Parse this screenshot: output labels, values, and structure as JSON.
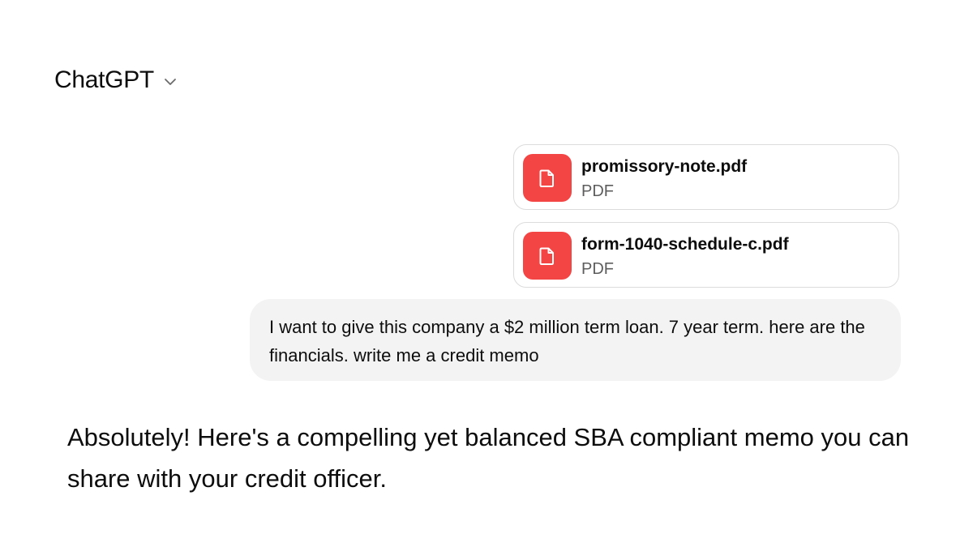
{
  "header": {
    "title": "ChatGPT",
    "chevron_icon": "chevron-down-icon"
  },
  "attachments": [
    {
      "name": "promissory-note.pdf",
      "type": "PDF",
      "icon": "document-icon",
      "icon_color": "#f44545"
    },
    {
      "name": "form-1040-schedule-c.pdf",
      "type": "PDF",
      "icon": "document-icon",
      "icon_color": "#f44545"
    }
  ],
  "user_message": {
    "text": "I want to give this company a $2 million term loan. 7 year term. here are the financials. write me a credit memo"
  },
  "assistant_message": {
    "text": "Absolutely! Here's a compelling yet balanced SBA compliant memo you can share with your credit officer."
  }
}
